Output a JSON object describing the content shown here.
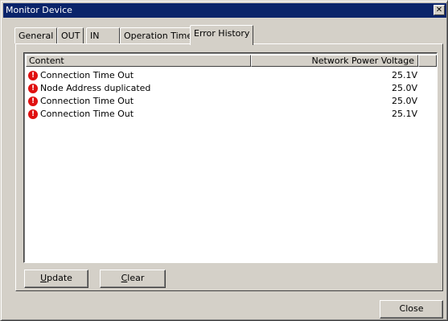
{
  "window": {
    "title": "Monitor Device",
    "close_glyph": "✕"
  },
  "tabs": [
    {
      "label": "General",
      "active": false
    },
    {
      "label": "OUT",
      "active": false
    },
    {
      "label": "IN",
      "active": false
    },
    {
      "label": "Operation Time",
      "active": false
    },
    {
      "label": "Error History",
      "active": true
    }
  ],
  "error_list": {
    "columns": {
      "content": "Content",
      "voltage": "Network Power Voltage"
    },
    "rows": [
      {
        "icon": "error-icon",
        "content": "Connection Time Out",
        "voltage": "25.1V"
      },
      {
        "icon": "error-icon",
        "content": "Node Address duplicated",
        "voltage": "25.0V"
      },
      {
        "icon": "error-icon",
        "content": "Connection Time Out",
        "voltage": "25.0V"
      },
      {
        "icon": "error-icon",
        "content": "Connection Time Out",
        "voltage": "25.1V"
      }
    ]
  },
  "buttons": {
    "update": {
      "mnemonic": "U",
      "rest": "pdate"
    },
    "clear": {
      "mnemonic": "C",
      "rest": "lear"
    },
    "close": "Close"
  },
  "colors": {
    "titlebar": "#0a246a",
    "face": "#d4d0c8",
    "error": "#e01010"
  }
}
